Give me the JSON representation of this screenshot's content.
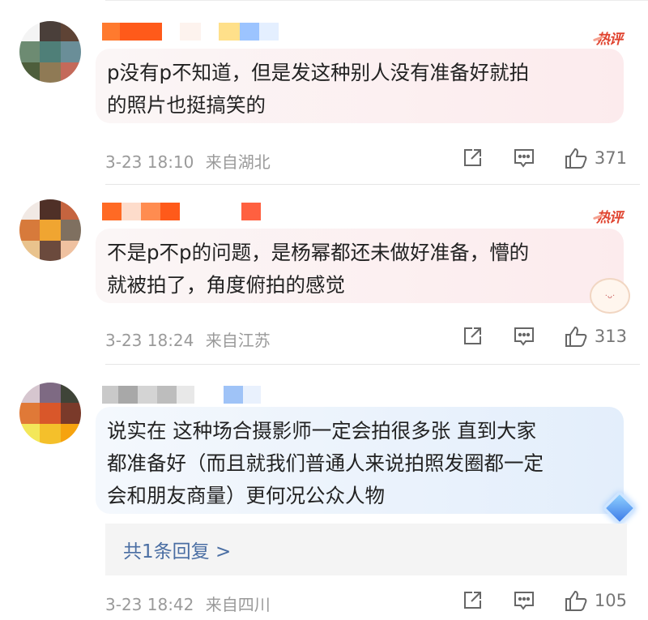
{
  "comments": [
    {
      "hot_label": "热评",
      "text": "p没有p不知道，但是发这种别人没有准备好就拍\n的照片也挺搞笑的",
      "time": "3-23 18:10",
      "location": "来自湖北",
      "likes": "371",
      "icons": {
        "share": "share-icon",
        "comment": "comment-icon",
        "like": "thumbs-up-icon"
      }
    },
    {
      "hot_label": "热评",
      "text": "不是p不p的问题，是杨幂都还未做好准备，懵的\n就被拍了，角度俯拍的感觉",
      "time": "3-23 18:24",
      "location": "来自江苏",
      "likes": "313",
      "icons": {
        "share": "share-icon",
        "comment": "comment-icon",
        "like": "thumbs-up-icon"
      }
    },
    {
      "text": "说实在 这种场合摄影师一定会拍很多张 直到大家\n都准备好（而且就我们普通人来说拍照发圈都一定\n会和朋友商量）更何况公众人物",
      "reply_link": "共1条回复 >",
      "time": "3-23 18:42",
      "location": "来自四川",
      "likes": "105",
      "icons": {
        "share": "share-icon",
        "comment": "comment-icon",
        "like": "thumbs-up-icon"
      }
    }
  ],
  "colors": {
    "hot_badge": "#e0432f",
    "reply_link": "#4a6ea3",
    "meta_text": "#9a9a9a"
  }
}
